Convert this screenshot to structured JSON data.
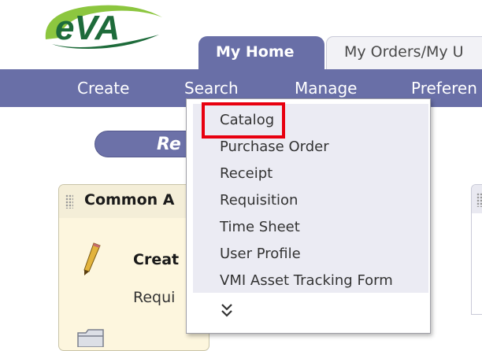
{
  "logo": {
    "text": "eVA",
    "brand_color": "#1d6b3a",
    "accent_color": "#8cc63f"
  },
  "tabs": [
    {
      "label": "My Home",
      "active": true
    },
    {
      "label": "My Orders/My U",
      "active": false
    }
  ],
  "nav": {
    "items": [
      "Create",
      "Search",
      "Manage",
      "Preferen"
    ],
    "background": "#696fa7"
  },
  "dropdown": {
    "items": [
      "Catalog",
      "Purchase Order",
      "Receipt",
      "Requisition",
      "Time Sheet",
      "User Profile",
      "VMI Asset Tracking Form"
    ],
    "highlighted": "Catalog",
    "highlight_color": "#e8000f",
    "more_icon": "double-chevron-down-icon"
  },
  "pill": {
    "label": "Re"
  },
  "panel": {
    "title": "Common A",
    "action_label": "Creat",
    "action_sub": "Requi",
    "icons": [
      "pencil-icon",
      "folder-icon"
    ]
  }
}
